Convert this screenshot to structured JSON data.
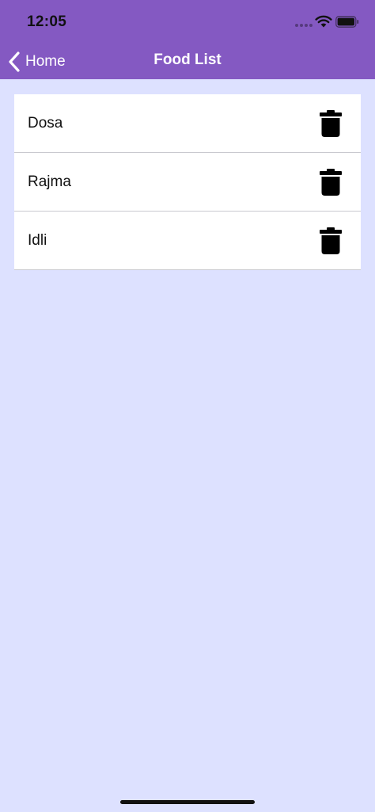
{
  "status_bar": {
    "time": "12:05",
    "icons": [
      "cellular-signal-icon",
      "wifi-icon",
      "battery-icon"
    ]
  },
  "nav": {
    "back_label": "Home",
    "back_icon": "chevron-left-icon",
    "title": "Food List"
  },
  "food_items": [
    {
      "name": "Dosa",
      "action_icon": "trash-icon"
    },
    {
      "name": "Rajma",
      "action_icon": "trash-icon"
    },
    {
      "name": "Idli",
      "action_icon": "trash-icon"
    }
  ],
  "colors": {
    "header": "#8459c2",
    "background": "#dde1ff",
    "list_background": "#ffffff",
    "text": "#111111"
  }
}
